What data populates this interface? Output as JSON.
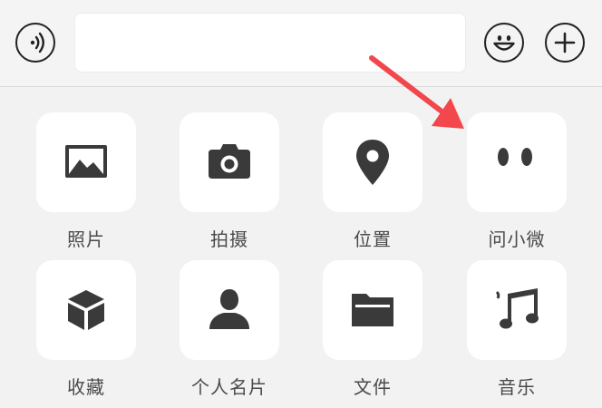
{
  "input_bar": {
    "voice_icon": "voice-input-icon",
    "emoji_icon": "emoji-icon",
    "plus_icon": "plus-icon",
    "text_value": ""
  },
  "panel": {
    "items": [
      {
        "label": "照片",
        "icon": "image-icon"
      },
      {
        "label": "拍摄",
        "icon": "camera-icon"
      },
      {
        "label": "位置",
        "icon": "location-pin-icon"
      },
      {
        "label": "问小微",
        "icon": "xiaowei-eyes-icon"
      },
      {
        "label": "收藏",
        "icon": "cube-icon"
      },
      {
        "label": "个人名片",
        "icon": "person-card-icon"
      },
      {
        "label": "文件",
        "icon": "folder-icon"
      },
      {
        "label": "音乐",
        "icon": "music-note-icon"
      }
    ]
  },
  "colors": {
    "icon": "#3a3a3a",
    "label": "#4a4a4a",
    "tile_bg": "#ffffff",
    "panel_bg": "#f2f2f2",
    "annotation_arrow": "#f2474d"
  }
}
